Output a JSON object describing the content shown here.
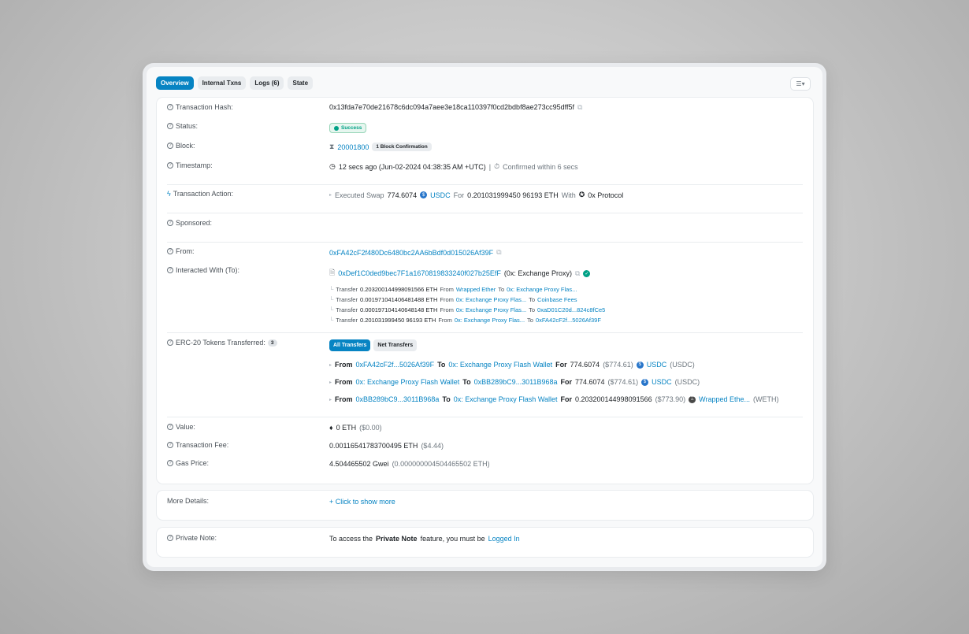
{
  "tabs": [
    {
      "label": "Overview",
      "active": true
    },
    {
      "label": "Internal Txns",
      "active": false
    },
    {
      "label": "Logs (6)",
      "active": false
    },
    {
      "label": "State",
      "active": false
    }
  ],
  "view_toggle_icon": "list-chevron-icon",
  "tx": {
    "hash_label": "Transaction Hash:",
    "hash": "0x13fda7e70de21678c6dc094a7aee3e18ca110397f0cd2bdbf8ae273cc95dff5f",
    "status_label": "Status:",
    "status": "Success",
    "block_label": "Block:",
    "block": "20001800",
    "block_confirm": "1 Block Confirmation",
    "timestamp_label": "Timestamp:",
    "timestamp": "12 secs ago (Jun-02-2024 04:38:35 AM +UTC)",
    "timestamp_sep": "|",
    "confirmed": "Confirmed within 6 secs",
    "action_label": "Transaction Action:",
    "action": {
      "prefix": "Executed Swap",
      "amount": "774.6074",
      "token": "USDC",
      "for_word": "For",
      "for_amount": "0.201031999450 96193 ETH",
      "with_word": "With",
      "protocol": "0x Protocol"
    },
    "sponsored_label": "Sponsored:",
    "from_label": "From:",
    "from": "0xFA42cF2f480Dc6480bc2AA6bBdf0d015026Af39F",
    "interacted_label": "Interacted With (To):",
    "interacted": "0xDef1C0ded9bec7F1a1670819833240f027b25EfF",
    "interacted_name": "(0x: Exchange Proxy)",
    "internal_transfers": [
      {
        "prefix": "Transfer",
        "amount": "0.203200144998091566 ETH",
        "from_word": "From",
        "from": "Wrapped Ether",
        "to_word": "To",
        "to": "0x: Exchange Proxy Flas..."
      },
      {
        "prefix": "Transfer",
        "amount": "0.001971041406481488 ETH",
        "from_word": "From",
        "from": "0x: Exchange Proxy Flas...",
        "to_word": "To",
        "to": "Coinbase Fees"
      },
      {
        "prefix": "Transfer",
        "amount": "0.000197104140648148 ETH",
        "from_word": "From",
        "from": "0x: Exchange Proxy Flas...",
        "to_word": "To",
        "to": "0xaD01C20d...824c8fCe5"
      },
      {
        "prefix": "Transfer",
        "amount": "0.201031999450 96193 ETH",
        "from_word": "From",
        "from": "0x: Exchange Proxy Flas...",
        "to_word": "To",
        "to": "0xFA42cF2f...5026Af39F"
      }
    ],
    "erc20_label": "ERC-20 Tokens Transferred:",
    "erc20_count": "3",
    "erc20_tabs": [
      "All Transfers",
      "Net Transfers"
    ],
    "erc20_transfers": [
      {
        "from_word": "From",
        "from": "0xFA42cF2f...5026Af39F",
        "to_word": "To",
        "to": "0x: Exchange Proxy Flash Wallet",
        "for_word": "For",
        "amount": "774.6074",
        "usd": "($774.61)",
        "token": "USDC",
        "symbol": "(USDC)"
      },
      {
        "from_word": "From",
        "from": "0x: Exchange Proxy Flash Wallet",
        "to_word": "To",
        "to": "0xBB289bC9...3011B968a",
        "for_word": "For",
        "amount": "774.6074",
        "usd": "($774.61)",
        "token": "USDC",
        "symbol": "(USDC)"
      },
      {
        "from_word": "From",
        "from": "0xBB289bC9...3011B968a",
        "to_word": "To",
        "to": "0x: Exchange Proxy Flash Wallet",
        "for_word": "For",
        "amount": "0.203200144998091566",
        "usd": "($773.90)",
        "token": "Wrapped Ethe...",
        "symbol": "(WETH)"
      }
    ],
    "value_label": "Value:",
    "value": "0 ETH",
    "value_usd": "($0.00)",
    "fee_label": "Transaction Fee:",
    "fee": "0.00116541783700495 ETH",
    "fee_usd": "($4.44)",
    "gas_label": "Gas Price:",
    "gas": "4.504465502 Gwei",
    "gas_eth": "(0.000000004504465502 ETH)"
  },
  "more": {
    "label": "More Details:",
    "link": "+ Click to show more"
  },
  "note": {
    "label": "Private Note:",
    "text_prefix": "To access the",
    "text_bold": "Private Note",
    "text_mid": "feature, you must be",
    "link": "Logged In"
  }
}
